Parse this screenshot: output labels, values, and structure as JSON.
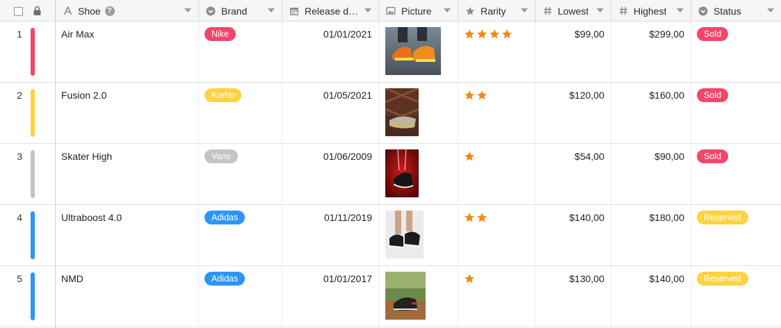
{
  "columns": [
    {
      "key": "shoe",
      "label": "Shoe",
      "icon": "text-type-icon"
    },
    {
      "key": "brand",
      "label": "Brand",
      "icon": "single-select-icon"
    },
    {
      "key": "release",
      "label": "Release d…",
      "icon": "calendar-icon"
    },
    {
      "key": "picture",
      "label": "Picture",
      "icon": "image-icon"
    },
    {
      "key": "rarity",
      "label": "Rarity",
      "icon": "star-icon"
    },
    {
      "key": "lowest",
      "label": "Lowest",
      "icon": "number-icon"
    },
    {
      "key": "highest",
      "label": "Highest",
      "icon": "number-icon"
    },
    {
      "key": "status",
      "label": "Status",
      "icon": "single-select-icon"
    }
  ],
  "colors": {
    "red": "#f2466b",
    "yellow": "#ffd23f",
    "gray": "#c4c4c4",
    "blue": "#2d95f5",
    "star": "#f08a15",
    "sold": "#f2466b",
    "reserved": "#ffd23f"
  },
  "rows": [
    {
      "num": "1",
      "color": "#f2466b",
      "shoe": "Air Max",
      "brand": "Nike",
      "brand_color": "#f2466b",
      "release": "01/01/2021",
      "picture": "sneaker-photo-orange",
      "rarity": 4,
      "lowest": "$99,00",
      "highest": "$299,00",
      "status": "Sold",
      "status_color": "#f2466b"
    },
    {
      "num": "2",
      "color": "#ffd23f",
      "shoe": "Fusion 2.0",
      "brand": "Karhu",
      "brand_color": "#ffd23f",
      "release": "01/05/2021",
      "picture": "sneaker-photo-rug",
      "rarity": 2,
      "lowest": "$120,00",
      "highest": "$160,00",
      "status": "Sold",
      "status_color": "#f2466b"
    },
    {
      "num": "3",
      "color": "#c4c4c4",
      "shoe": "Skater High",
      "brand": "Vans",
      "brand_color": "#c4c4c4",
      "release": "01/06/2009",
      "picture": "sneaker-photo-red",
      "rarity": 1,
      "lowest": "$54,00",
      "highest": "$90,00",
      "status": "Sold",
      "status_color": "#f2466b"
    },
    {
      "num": "4",
      "color": "#2d95f5",
      "shoe": "Ultraboost 4.0",
      "brand": "Adidas",
      "brand_color": "#2d95f5",
      "release": "01/11/2019",
      "picture": "sneaker-photo-black",
      "rarity": 2,
      "lowest": "$140,00",
      "highest": "$180,00",
      "status": "Reserved",
      "status_color": "#ffd23f"
    },
    {
      "num": "5",
      "color": "#2d95f5",
      "shoe": "NMD",
      "brand": "Adidas",
      "brand_color": "#2d95f5",
      "release": "01/01/2017",
      "picture": "sneaker-photo-outdoor",
      "rarity": 1,
      "lowest": "$130,00",
      "highest": "$140,00",
      "status": "Reserved",
      "status_color": "#ffd23f"
    }
  ]
}
